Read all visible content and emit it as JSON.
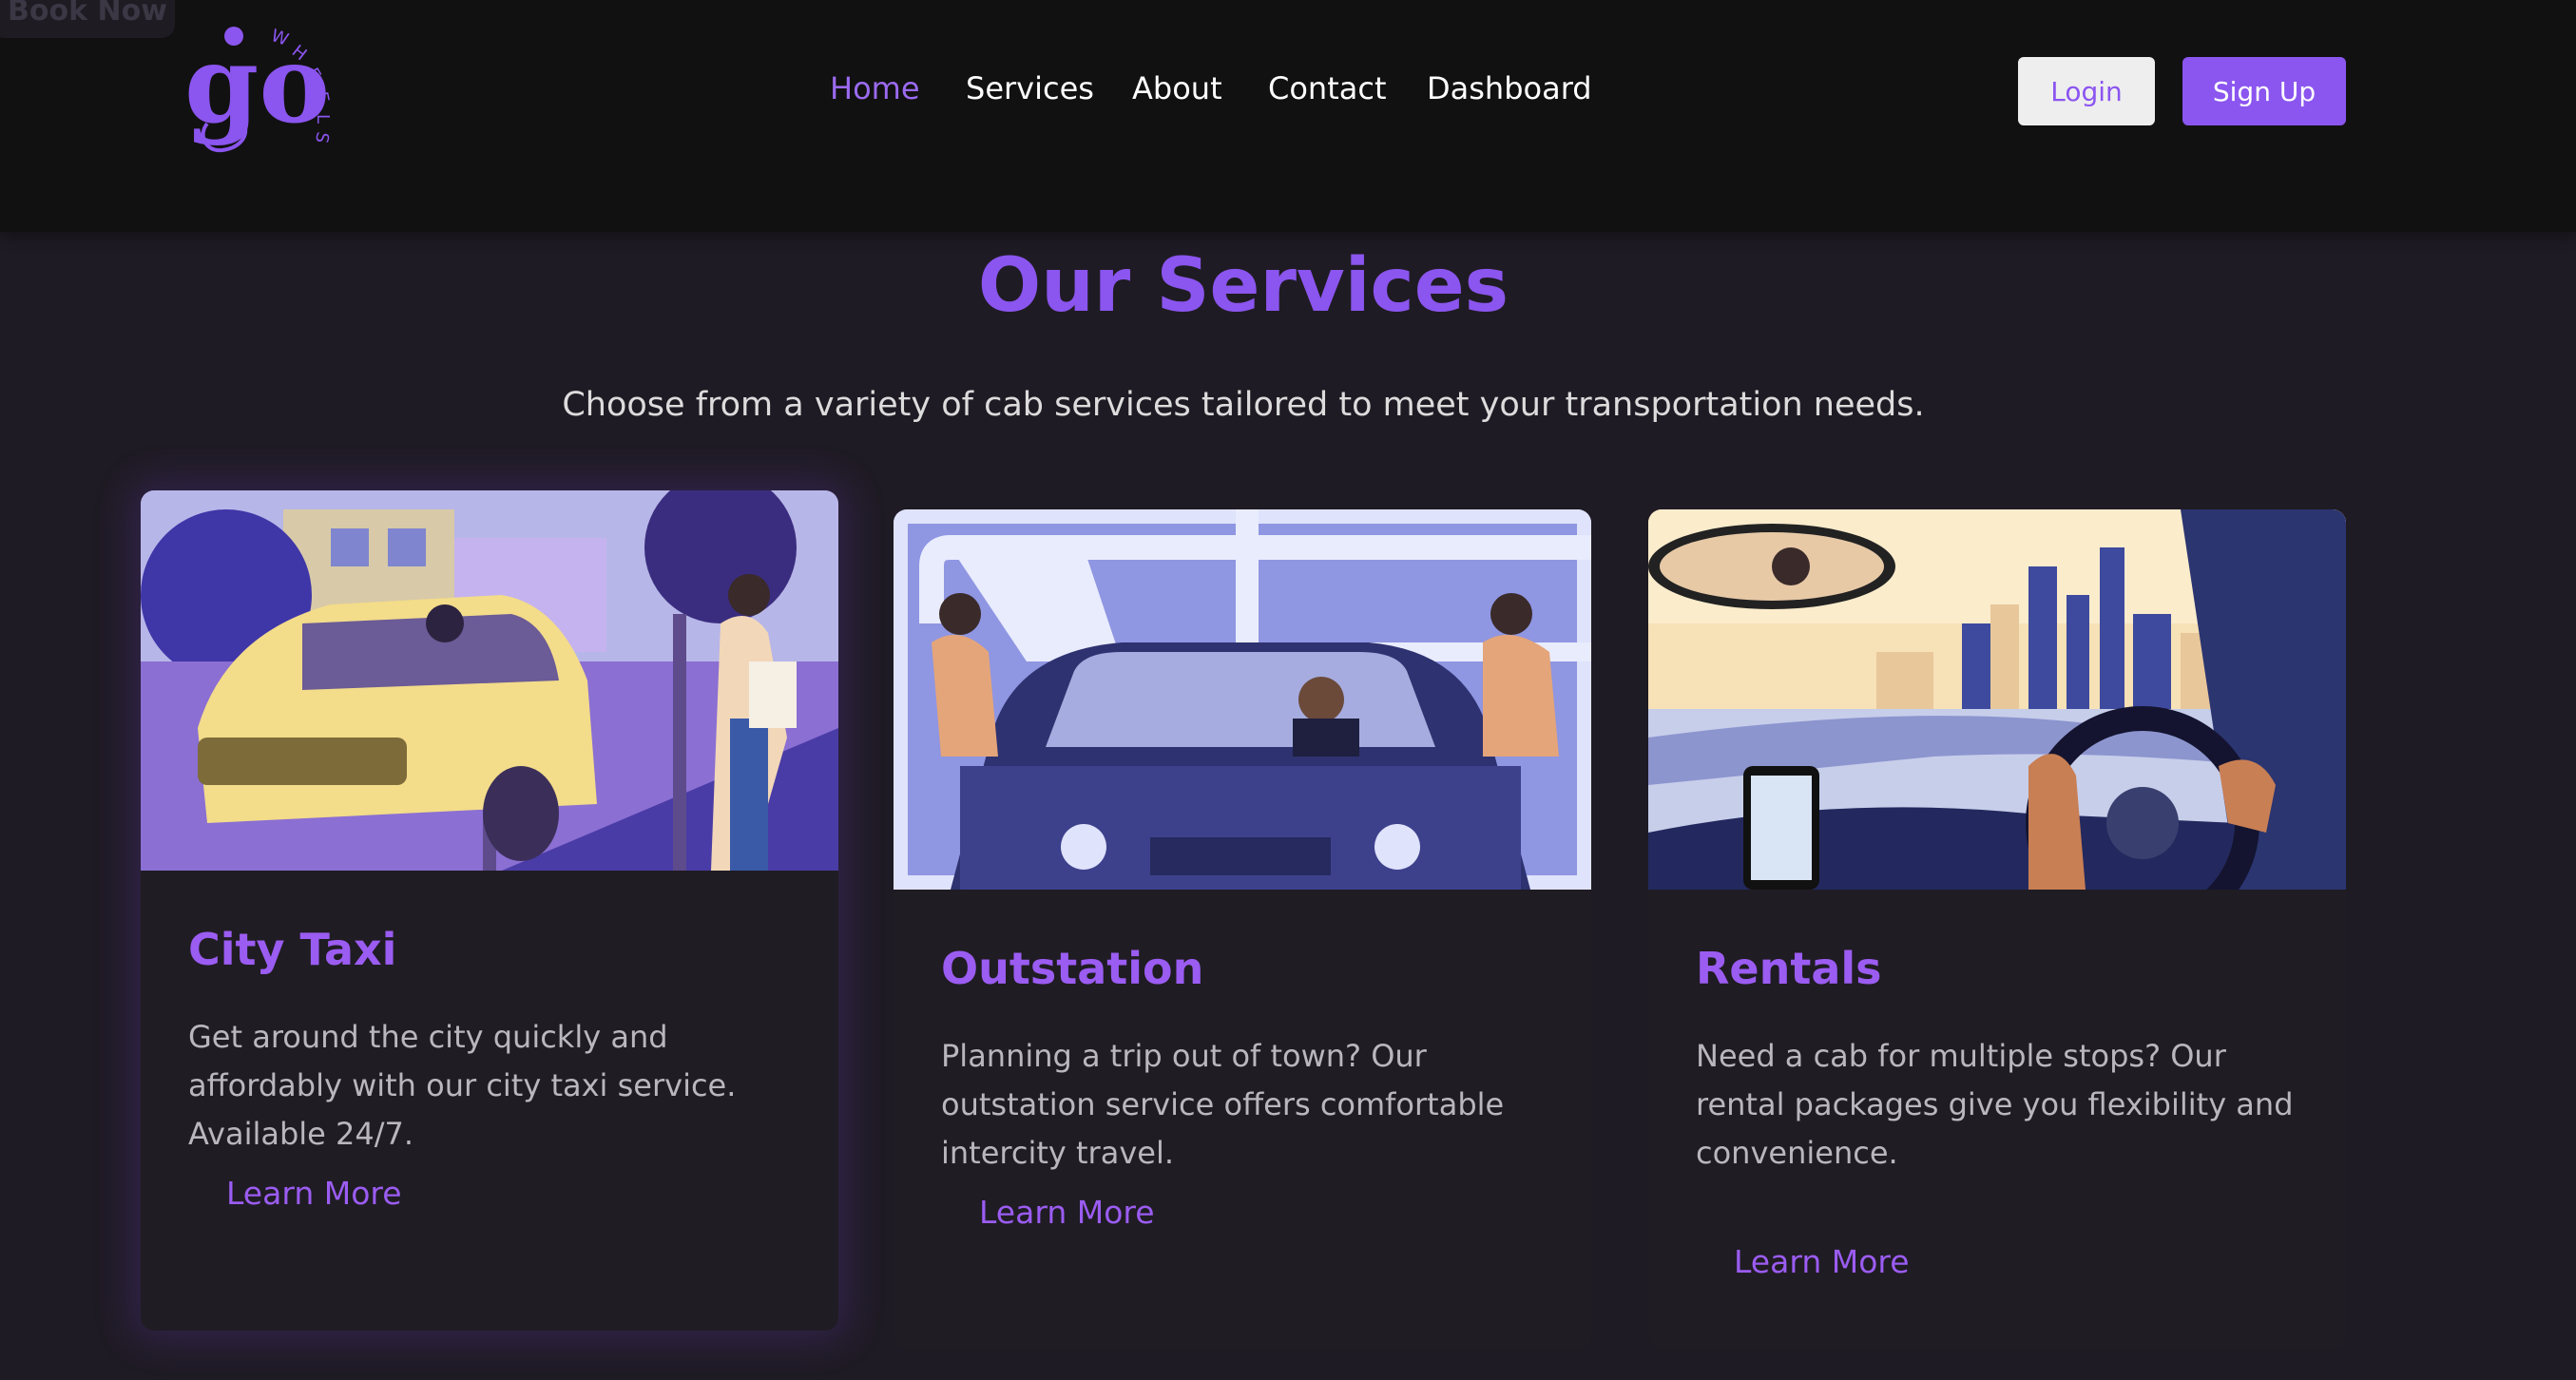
{
  "header": {
    "book_now": "Book Now",
    "logo_text": "go",
    "logo_tagline": "WHEELS",
    "nav": [
      {
        "label": "Home",
        "active": true
      },
      {
        "label": "Services",
        "active": false
      },
      {
        "label": "About",
        "active": false
      },
      {
        "label": "Contact",
        "active": false
      },
      {
        "label": "Dashboard",
        "active": false
      }
    ],
    "login_label": "Login",
    "signup_label": "Sign Up"
  },
  "services": {
    "title": "Our Services",
    "subtitle": "Choose from a variety of cab services tailored to meet your transportation needs.",
    "cards": [
      {
        "title": "City Taxi",
        "description": "Get around the city quickly and affordably with our city taxi service. Available 24/7.",
        "link_label": "Learn More",
        "image": "city-taxi-illustration"
      },
      {
        "title": "Outstation",
        "description": "Planning a trip out of town? Our outstation service offers comfortable intercity travel.",
        "link_label": "Learn More",
        "image": "outstation-car-illustration"
      },
      {
        "title": "Rentals",
        "description": "Need a cab for multiple stops? Our rental packages give you flexibility and convenience.",
        "link_label": "Learn More",
        "image": "rentals-driver-view-illustration"
      }
    ]
  },
  "colors": {
    "accent": "#8b55ef",
    "header_bg": "#111111",
    "page_bg": "#1f1b24",
    "card_bg": "#1f1c23"
  }
}
